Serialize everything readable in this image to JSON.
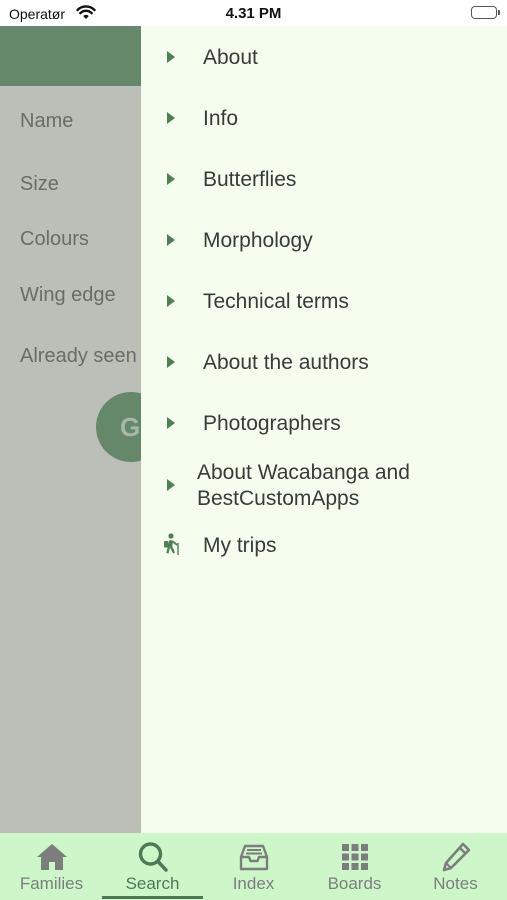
{
  "status_bar": {
    "carrier": "Operatør",
    "time": "4.31 PM"
  },
  "search_screen": {
    "filters": [
      "Name",
      "Size",
      "Colours",
      "Wing edge",
      "Already seen"
    ],
    "go_button_label": "G"
  },
  "menu": {
    "items": [
      {
        "label": "About",
        "icon": "chevron-right-icon"
      },
      {
        "label": "Info",
        "icon": "chevron-right-icon"
      },
      {
        "label": "Butterflies",
        "icon": "chevron-right-icon"
      },
      {
        "label": "Morphology",
        "icon": "chevron-right-icon"
      },
      {
        "label": "Technical terms",
        "icon": "chevron-right-icon"
      },
      {
        "label": "About the authors",
        "icon": "chevron-right-icon"
      },
      {
        "label": "Photographers",
        "icon": "chevron-right-icon"
      },
      {
        "label": "About Wacabanga and BestCustomApps",
        "icon": "chevron-right-icon"
      },
      {
        "label": "My trips",
        "icon": "hiker-icon"
      }
    ]
  },
  "tabbar": {
    "tabs": [
      {
        "label": "Families",
        "icon": "home-icon",
        "active": false
      },
      {
        "label": "Search",
        "icon": "search-icon",
        "active": true
      },
      {
        "label": "Index",
        "icon": "inbox-icon",
        "active": false
      },
      {
        "label": "Boards",
        "icon": "grid-icon",
        "active": false
      },
      {
        "label": "Notes",
        "icon": "pencil-icon",
        "active": false
      }
    ]
  },
  "colors": {
    "accent": "#4d7a54",
    "drawer_bg": "#f4fdee",
    "tabbar_bg": "#cdf7c9",
    "underlay_bg": "#bcbfb8",
    "header_green": "#65886b"
  }
}
